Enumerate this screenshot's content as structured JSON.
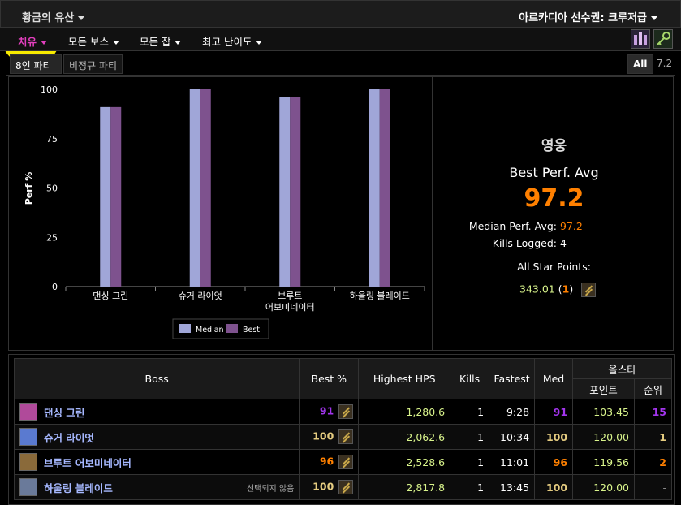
{
  "topbar": {
    "zone": "황금의 유산",
    "season": "아르카디아 선수권: 크루저급"
  },
  "filters": {
    "spec": "치유",
    "boss": "모든 보스",
    "class": "모든 잡",
    "difficulty": "최고 난이도"
  },
  "tabs": {
    "party": "8인 파티",
    "nonstandard": "비정규 파티",
    "all": "All",
    "version": "7.2"
  },
  "chart_data": {
    "type": "bar",
    "categories": [
      "댄싱 그린",
      "슈거 라이엇",
      "브루트 어보미네이터",
      "하울링 블레이드"
    ],
    "series": [
      {
        "name": "Median",
        "color": "#a0a6d8",
        "values": [
          91,
          100,
          96,
          100
        ]
      },
      {
        "name": "Best",
        "color": "#7e528e",
        "values": [
          91,
          100,
          96,
          100
        ]
      }
    ],
    "ylabel": "Perf %",
    "ylim": [
      0,
      100
    ],
    "yticks": [
      0,
      25,
      50,
      75,
      100
    ],
    "legend": "bottom"
  },
  "summary": {
    "title": "영웅",
    "best_label": "Best Perf. Avg",
    "best_value": "97.2",
    "median_label": "Median Perf. Avg:",
    "median_value": "97.2",
    "kills_label": "Kills Logged:",
    "kills_value": "4",
    "star_label": "All Star Points:",
    "star_points": "343.01",
    "star_rank": "1",
    "colors": {
      "best": "#ff8000",
      "points": "#d8f38b"
    }
  },
  "table": {
    "headers": {
      "boss": "Boss",
      "best": "Best %",
      "hps": "Highest HPS",
      "kills": "Kills",
      "fastest": "Fastest",
      "med": "Med",
      "allstar": "올스타",
      "points": "포인트",
      "rank": "순위"
    },
    "rows": [
      {
        "boss": "댄싱 그린",
        "note": "",
        "best": "91",
        "hps": "1,280.6",
        "kills": "1",
        "fastest": "9:28",
        "med": "91",
        "points": "103.45",
        "rank": "15",
        "color": "c-purple",
        "rank_color": "c-purple",
        "avatar": "#b04a9a"
      },
      {
        "boss": "슈거 라이엇",
        "note": "",
        "best": "100",
        "hps": "2,062.6",
        "kills": "1",
        "fastest": "10:34",
        "med": "100",
        "points": "120.00",
        "rank": "1",
        "color": "c-gold",
        "rank_color": "c-gold",
        "avatar": "#5a7ad0"
      },
      {
        "boss": "브루트 어보미네이터",
        "note": "",
        "best": "96",
        "hps": "2,528.6",
        "kills": "1",
        "fastest": "11:01",
        "med": "96",
        "points": "119.56",
        "rank": "2",
        "color": "c-orange",
        "rank_color": "c-orange",
        "avatar": "#8a6a3a"
      },
      {
        "boss": "하울링 블레이드",
        "note": "선택되지 않음",
        "best": "100",
        "hps": "2,817.8",
        "kills": "1",
        "fastest": "13:45",
        "med": "100",
        "points": "120.00",
        "rank": "-",
        "color": "c-gold",
        "rank_color": "c-gray",
        "avatar": "#6a7a9a"
      }
    ]
  }
}
